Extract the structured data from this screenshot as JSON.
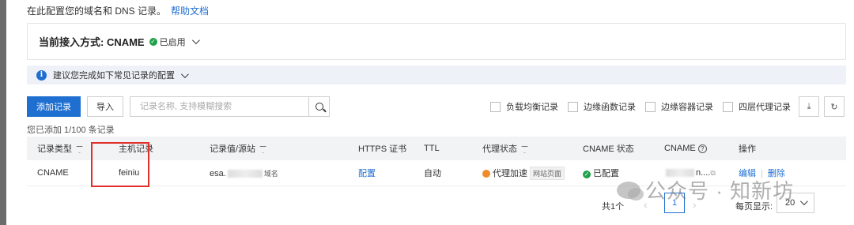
{
  "intro": {
    "text": "在此配置您的域名和 DNS 记录。",
    "help_link": "帮助文档"
  },
  "access_mode": {
    "label": "当前接入方式: CNAME",
    "status": "已启用"
  },
  "tip": {
    "text": "建议您完成如下常见记录的配置"
  },
  "toolbar": {
    "add_label": "添加记录",
    "import_label": "导入",
    "search_placeholder": "记录名称, 支持模糊搜索",
    "filters": [
      "负载均衡记录",
      "边缘函数记录",
      "边缘容器记录",
      "四层代理记录"
    ]
  },
  "record_count": "您已添加 1/100 条记录",
  "table": {
    "headers": {
      "type": "记录类型",
      "host": "主机记录",
      "value": "记录值/源站",
      "https": "HTTPS 证书",
      "ttl": "TTL",
      "proxy": "代理状态",
      "cname_status": "CNAME 状态",
      "cname": "CNAME",
      "actions": "操作"
    },
    "rows": [
      {
        "type": "CNAME",
        "host": "feiniu",
        "value_prefix": "esa.",
        "value_tag": "域名",
        "https": "配置",
        "ttl": "自动",
        "proxy": "代理加速",
        "proxy_tag": "网站页面",
        "cname_status": "已配置",
        "cname_suffix": "n....",
        "edit": "编辑",
        "delete": "删除"
      }
    ]
  },
  "pager": {
    "total": "共1个",
    "current": "1",
    "size_label": "每页显示:",
    "size": "20"
  },
  "watermark": "公众号 · 知新坊",
  "colors": {
    "accent": "#1f6fd1",
    "success": "#1ea048",
    "highlight": "#e0302b"
  }
}
